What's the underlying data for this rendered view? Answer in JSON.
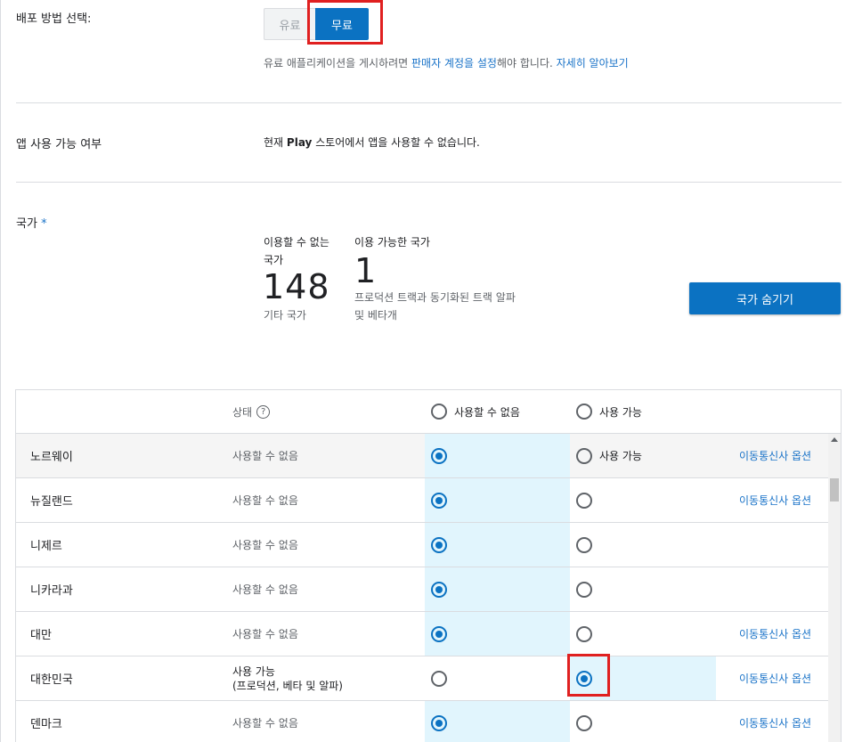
{
  "distribution": {
    "label": "배포 방법 선택:",
    "paid": "유료",
    "free": "무료",
    "note_prefix": "유료 애플리케이션을 게시하려면 ",
    "note_link": "판매자 계정을 설정",
    "note_suffix": "해야 합니다. ",
    "learn_more": "자세히 알아보기"
  },
  "availability": {
    "label": "앱 사용 가능 여부",
    "text_prefix": "현재 ",
    "text_bold": "Play",
    "text_suffix": " 스토어에서 앱을 사용할 수 없습니다."
  },
  "countries": {
    "label": "국가",
    "required": "*",
    "unavailable_title_1": "이용할 수 없는",
    "unavailable_title_2": "국가",
    "unavailable_count": "148",
    "unavailable_sub": "기타 국가",
    "available_title": "이용 가능한 국가",
    "available_count": "1",
    "available_sub_1": "프로덕션 트랙과 동기화된 트랙 알파",
    "available_sub_2": "및 베타개",
    "hide_button": "국가 숨기기"
  },
  "table": {
    "header": {
      "status": "상태",
      "help": "?",
      "unavailable": "사용할 수 없음",
      "available": "사용 가능"
    },
    "rows": [
      {
        "name": "노르웨이",
        "status": "사용할 수 없음",
        "selected": "unavailable",
        "avail_label": "사용 가능",
        "carrier": "이동통신사 옵션"
      },
      {
        "name": "뉴질랜드",
        "status": "사용할 수 없음",
        "selected": "unavailable",
        "avail_label": "",
        "carrier": "이동통신사 옵션"
      },
      {
        "name": "니제르",
        "status": "사용할 수 없음",
        "selected": "unavailable",
        "avail_label": "",
        "carrier": ""
      },
      {
        "name": "니카라과",
        "status": "사용할 수 없음",
        "selected": "unavailable",
        "avail_label": "",
        "carrier": ""
      },
      {
        "name": "대만",
        "status": "사용할 수 없음",
        "selected": "unavailable",
        "avail_label": "",
        "carrier": "이동통신사 옵션"
      },
      {
        "name": "대한민국",
        "status": "사용 가능",
        "status_2": "(프로덕션, 베타 및 알파)",
        "selected": "available",
        "avail_label": "",
        "carrier": "이동통신사 옵션"
      },
      {
        "name": "덴마크",
        "status": "사용할 수 없음",
        "selected": "unavailable",
        "avail_label": "",
        "carrier": "이동통신사 옵션"
      }
    ]
  },
  "colors": {
    "primary": "#0b72c2",
    "highlight": "#e02020",
    "selected_cell": "#e1f5fd"
  }
}
